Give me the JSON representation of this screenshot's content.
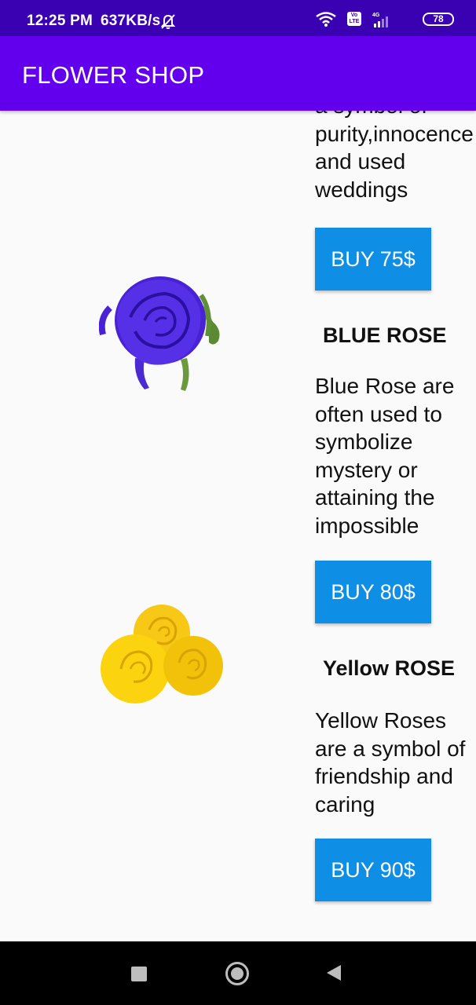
{
  "status_bar": {
    "time": "12:25 PM",
    "speed": "637KB/s",
    "battery": "78",
    "volte_label": "Vo LTE",
    "network_label": "4G",
    "icons": [
      "mute-bell-icon",
      "wifi-icon",
      "volte-icon",
      "signal-icon",
      "battery-icon"
    ]
  },
  "app_bar": {
    "title": "FLOWER SHOP"
  },
  "products": [
    {
      "description": "a symbol of purity,innocence and used weddings",
      "buy_label": "BUY 75$"
    },
    {
      "name": "BLUE ROSE",
      "description": "Blue Rose are often used to symbolize mystery or attaining the impossible",
      "buy_label": "BUY 80$",
      "image": "blue-rose-image"
    },
    {
      "name": "Yellow ROSE",
      "description": "Yellow Roses are a symbol of friendship and caring",
      "buy_label": "BUY 90$",
      "image": "yellow-rose-image"
    }
  ],
  "nav_bar": {
    "icons": [
      "recents-square-icon",
      "home-circle-icon",
      "back-triangle-icon"
    ]
  },
  "colors": {
    "status_bar": "#3a01b3",
    "app_bar": "#6200ee",
    "button": "#0e8fe5",
    "background": "#fafafa"
  }
}
